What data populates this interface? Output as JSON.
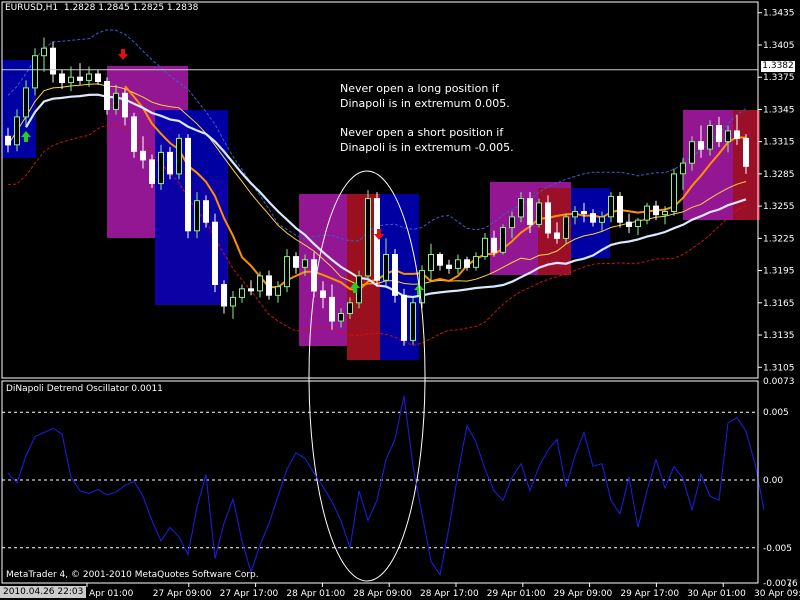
{
  "price_panel": {
    "symbol_tf": "EURUSD,H1",
    "ohlc": "1.2828 1.2845 1.2825 1.2838",
    "current_price_label": "1.3382",
    "y_ticks": [
      "1.3435",
      "1.3405",
      "1.3375",
      "1.3345",
      "1.3315",
      "1.3285",
      "1.3255",
      "1.3225",
      "1.3195",
      "1.3165",
      "1.3135",
      "1.3105"
    ],
    "annotation_line1": "Never open a long position if",
    "annotation_line2": "Dinapoli is in extremum 0.005.",
    "annotation_line3": "Never open a short position if",
    "annotation_line4": "Dinapoli is in extremum -0.005."
  },
  "oscillator_panel": {
    "title": "DiNapoli Detrend Oscillator 0.0011",
    "y_ticks": [
      "0.0073",
      "0.005",
      "0.00",
      "-0.005",
      "-0.0076"
    ],
    "copyright": "MetaTrader 4, © 2001-2010 MetaQuotes Software Corp."
  },
  "time_axis": {
    "cursor_time": "2010.04.26 22:03",
    "labels": [
      "Apr 01:00",
      "27 Apr 09:00",
      "27 Apr 17:00",
      "28 Apr 01:00",
      "28 Apr 09:00",
      "28 Apr 17:00",
      "29 Apr 01:00",
      "29 Apr 09:00",
      "29 Apr 17:00",
      "30 Apr 01:00",
      "30 Apr 09:00"
    ]
  },
  "colors": {
    "background": "#000000",
    "bull_candle": "#90ee90",
    "bear_candle": "#ffffff",
    "oscillator_line": "#1e1ee6",
    "blue_box": "#0000b0",
    "magenta_box": "#a0189e",
    "red_box": "#9b1020",
    "upper_band": "#3a5fcd",
    "lower_band": "#d01010",
    "orange_ma": "#ff9000",
    "yellow_ma": "#ffd040",
    "white_ma": "#d8e8ff"
  },
  "chart_data": [
    {
      "type": "candlestick",
      "title": "EURUSD,H1",
      "ylim": [
        1.3095,
        1.3445
      ],
      "y_ticks": [
        1.3435,
        1.3405,
        1.3375,
        1.3345,
        1.3315,
        1.3285,
        1.3255,
        1.3225,
        1.3195,
        1.3165,
        1.3135,
        1.3105
      ],
      "current_price": 1.3382,
      "ohlc": [
        [
          1.332,
          1.3328,
          1.3305,
          1.3312
        ],
        [
          1.3312,
          1.3345,
          1.3306,
          1.3338
        ],
        [
          1.3338,
          1.3372,
          1.333,
          1.3365
        ],
        [
          1.3365,
          1.3402,
          1.3358,
          1.3395
        ],
        [
          1.3395,
          1.3412,
          1.338,
          1.3402
        ],
        [
          1.3402,
          1.3408,
          1.337,
          1.3378
        ],
        [
          1.3378,
          1.3382,
          1.3364,
          1.337
        ],
        [
          1.337,
          1.3385,
          1.3362,
          1.3375
        ],
        [
          1.3375,
          1.3388,
          1.3368,
          1.3372
        ],
        [
          1.3372,
          1.3385,
          1.3366,
          1.3378
        ],
        [
          1.3378,
          1.3382,
          1.3368,
          1.3371
        ],
        [
          1.3371,
          1.3375,
          1.334,
          1.3345
        ],
        [
          1.3345,
          1.3368,
          1.334,
          1.336
        ],
        [
          1.336,
          1.3364,
          1.333,
          1.3338
        ],
        [
          1.3338,
          1.3342,
          1.33,
          1.3306
        ],
        [
          1.3306,
          1.332,
          1.329,
          1.3298
        ],
        [
          1.3298,
          1.3303,
          1.3272,
          1.3276
        ],
        [
          1.3276,
          1.3312,
          1.327,
          1.3305
        ],
        [
          1.3305,
          1.331,
          1.328,
          1.3285
        ],
        [
          1.3285,
          1.3322,
          1.328,
          1.3318
        ],
        [
          1.3318,
          1.3322,
          1.3225,
          1.3232
        ],
        [
          1.3232,
          1.3268,
          1.3225,
          1.326
        ],
        [
          1.326,
          1.3265,
          1.3235,
          1.324
        ],
        [
          1.324,
          1.3248,
          1.3175,
          1.3182
        ],
        [
          1.3182,
          1.3186,
          1.3155,
          1.3162
        ],
        [
          1.3162,
          1.3176,
          1.315,
          1.317
        ],
        [
          1.317,
          1.3182,
          1.3165,
          1.3178
        ],
        [
          1.3178,
          1.3186,
          1.3172,
          1.3176
        ],
        [
          1.3176,
          1.3194,
          1.317,
          1.319
        ],
        [
          1.319,
          1.3195,
          1.3168,
          1.3172
        ],
        [
          1.3172,
          1.3185,
          1.3165,
          1.318
        ],
        [
          1.318,
          1.3215,
          1.3175,
          1.3208
        ],
        [
          1.3208,
          1.3212,
          1.3192,
          1.3198
        ],
        [
          1.3198,
          1.321,
          1.319,
          1.3205
        ],
        [
          1.3205,
          1.3212,
          1.317,
          1.3176
        ],
        [
          1.3176,
          1.3185,
          1.316,
          1.317
        ],
        [
          1.317,
          1.3182,
          1.314,
          1.3148
        ],
        [
          1.3148,
          1.316,
          1.3142,
          1.3155
        ],
        [
          1.3155,
          1.317,
          1.315,
          1.3165
        ],
        [
          1.3165,
          1.3195,
          1.316,
          1.319
        ],
        [
          1.319,
          1.327,
          1.3185,
          1.3262
        ],
        [
          1.3262,
          1.3268,
          1.318,
          1.3186
        ],
        [
          1.3186,
          1.3225,
          1.318,
          1.321
        ],
        [
          1.321,
          1.3215,
          1.3165,
          1.3172
        ],
        [
          1.3172,
          1.3178,
          1.3125,
          1.313
        ],
        [
          1.313,
          1.317,
          1.3126,
          1.3165
        ],
        [
          1.3165,
          1.32,
          1.316,
          1.3195
        ],
        [
          1.3195,
          1.322,
          1.3185,
          1.321
        ],
        [
          1.321,
          1.3212,
          1.3195,
          1.32
        ],
        [
          1.32,
          1.3205,
          1.3192,
          1.3197
        ],
        [
          1.3197,
          1.321,
          1.3192,
          1.3205
        ],
        [
          1.3205,
          1.3208,
          1.3195,
          1.3198
        ],
        [
          1.3198,
          1.3212,
          1.3195,
          1.3208
        ],
        [
          1.3208,
          1.323,
          1.3205,
          1.3225
        ],
        [
          1.3225,
          1.3232,
          1.3208,
          1.3212
        ],
        [
          1.3212,
          1.3238,
          1.321,
          1.3235
        ],
        [
          1.3235,
          1.325,
          1.3225,
          1.3245
        ],
        [
          1.3245,
          1.3268,
          1.324,
          1.3262
        ],
        [
          1.3262,
          1.3268,
          1.323,
          1.3238
        ],
        [
          1.3238,
          1.3262,
          1.3235,
          1.3258
        ],
        [
          1.3258,
          1.3265,
          1.3225,
          1.323
        ],
        [
          1.323,
          1.324,
          1.322,
          1.3225
        ],
        [
          1.3225,
          1.3248,
          1.322,
          1.3245
        ],
        [
          1.3245,
          1.3255,
          1.3238,
          1.325
        ],
        [
          1.325,
          1.3258,
          1.324,
          1.3248
        ],
        [
          1.3248,
          1.3252,
          1.3236,
          1.324
        ],
        [
          1.324,
          1.325,
          1.3232,
          1.3245
        ],
        [
          1.3245,
          1.3268,
          1.324,
          1.3264
        ],
        [
          1.3264,
          1.3268,
          1.3235,
          1.324
        ],
        [
          1.324,
          1.3248,
          1.323,
          1.3236
        ],
        [
          1.3236,
          1.3244,
          1.3228,
          1.3242
        ],
        [
          1.3242,
          1.3258,
          1.3238,
          1.3255
        ],
        [
          1.3255,
          1.326,
          1.3242,
          1.3247
        ],
        [
          1.3247,
          1.3255,
          1.3238,
          1.325
        ],
        [
          1.325,
          1.329,
          1.3246,
          1.3285
        ],
        [
          1.3285,
          1.33,
          1.327,
          1.3295
        ],
        [
          1.3295,
          1.332,
          1.3288,
          1.3315
        ],
        [
          1.3315,
          1.333,
          1.33,
          1.3308
        ],
        [
          1.3308,
          1.3335,
          1.3302,
          1.333
        ],
        [
          1.333,
          1.3338,
          1.331,
          1.3315
        ],
        [
          1.3315,
          1.333,
          1.3305,
          1.3325
        ],
        [
          1.3325,
          1.334,
          1.3312,
          1.3318
        ],
        [
          1.3318,
          1.3322,
          1.3285,
          1.3292
        ]
      ]
    },
    {
      "type": "line",
      "title": "DiNapoli Detrend Oscillator 0.0011",
      "ylim": [
        -0.0076,
        0.0073
      ],
      "y_ticks": [
        0.0073,
        0.005,
        0.0,
        -0.005,
        -0.0076
      ],
      "levels": [
        0.005,
        0.0,
        -0.005
      ],
      "series": [
        {
          "values": [
            0.0005,
            -0.0002,
            0.0018,
            0.0032,
            0.0035,
            0.0038,
            0.0034,
            0.0002,
            -0.0008,
            -0.001,
            -0.0007,
            -0.0011,
            -0.0009,
            -0.0004,
            -0.0001,
            -0.0012,
            -0.003,
            -0.0045,
            -0.0035,
            -0.0042,
            -0.0055,
            -0.002,
            0.0004,
            -0.0058,
            -0.0032,
            -0.0014,
            -0.0045,
            -0.0068,
            -0.0048,
            -0.0032,
            -0.0012,
            0.0008,
            0.002,
            0.0016,
            0.0005,
            -0.0005,
            -0.0016,
            -0.003,
            -0.005,
            -0.0008,
            -0.003,
            -0.0015,
            0.0015,
            0.003,
            0.0062,
            0.001,
            -0.0025,
            -0.006,
            -0.007,
            -0.0035,
            0.0005,
            0.004,
            0.0028,
            0.0008,
            -0.0008,
            -0.0015,
            0.0002,
            0.0012,
            -0.0008,
            0.001,
            0.0022,
            0.003,
            -0.0005,
            0.0018,
            0.0035,
            0.001,
            0.0012,
            -0.0015,
            -0.0025,
            0.0002,
            -0.0035,
            -0.0008,
            0.0015,
            -0.0006,
            0.001,
            0.0001,
            -0.0022,
            0.0004,
            -0.0012,
            -0.0015,
            0.0042,
            0.0046,
            0.0036,
            0.0012,
            -0.0022
          ]
        }
      ]
    }
  ]
}
